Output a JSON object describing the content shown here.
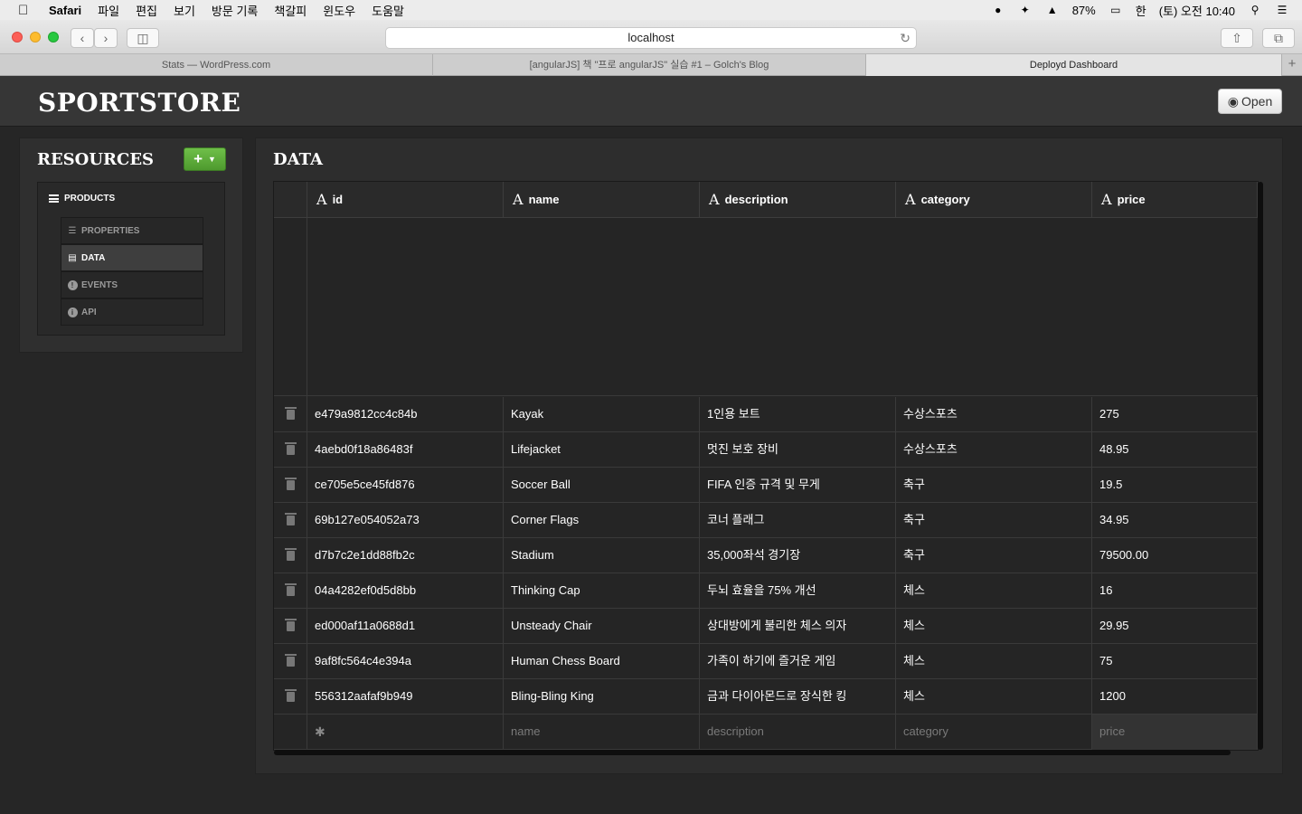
{
  "menubar": {
    "app_name": "Safari",
    "menus": [
      "파일",
      "편집",
      "보기",
      "방문 기록",
      "책갈피",
      "윈도우",
      "도움말"
    ],
    "battery": "87%",
    "input_method": "한",
    "clock": "(토) 오전 10:40"
  },
  "browser": {
    "url": "localhost",
    "tabs": [
      {
        "label": "Stats — WordPress.com"
      },
      {
        "label": "[angularJS] 책 \"프로 angularJS\" 실습 #1 – Golch's Blog"
      },
      {
        "label": "Deployd Dashboard"
      }
    ],
    "new_tab": "+"
  },
  "app": {
    "brand": "SPORTSTORE",
    "open_label": "Open"
  },
  "resources": {
    "title": "RESOURCES",
    "add_label": "+",
    "resource_name": "PRODUCTS",
    "subitems": [
      {
        "label": "PROPERTIES",
        "icon": "list-icon"
      },
      {
        "label": "DATA",
        "icon": "document-icon"
      },
      {
        "label": "EVENTS",
        "icon": "alert-icon"
      },
      {
        "label": "API",
        "icon": "info-icon"
      }
    ]
  },
  "data": {
    "title": "DATA",
    "type_glyph": "A",
    "columns": [
      "id",
      "name",
      "description",
      "category",
      "price"
    ],
    "rows": [
      {
        "id": "e479a9812cc4c84b",
        "name": "Kayak",
        "description": "1인용 보트",
        "category": "수상스포츠",
        "price": "275"
      },
      {
        "id": "4aebd0f18a86483f",
        "name": "Lifejacket",
        "description": "멋진 보호 장비",
        "category": "수상스포츠",
        "price": "48.95"
      },
      {
        "id": "ce705e5ce45fd876",
        "name": "Soccer Ball",
        "description": "FIFA 인증 규격 및 무게",
        "category": "축구",
        "price": "19.5"
      },
      {
        "id": "69b127e054052a73",
        "name": "Corner Flags",
        "description": "코너 플래그",
        "category": "축구",
        "price": "34.95"
      },
      {
        "id": "d7b7c2e1dd88fb2c",
        "name": "Stadium",
        "description": "35,000좌석 경기장",
        "category": "축구",
        "price": "79500.00"
      },
      {
        "id": "04a4282ef0d5d8bb",
        "name": "Thinking Cap",
        "description": "두뇌 효율을 75% 개선",
        "category": "체스",
        "price": "16"
      },
      {
        "id": "ed000af11a0688d1",
        "name": "Unsteady Chair",
        "description": "상대방에게 불리한 체스 의자",
        "category": "체스",
        "price": "29.95"
      },
      {
        "id": "9af8fc564c4e394a",
        "name": "Human Chess Board",
        "description": "가족이 하기에 즐거운 게임",
        "category": "체스",
        "price": "75"
      },
      {
        "id": "556312aafaf9b949",
        "name": "Bling-Bling King",
        "description": "금과 다이아몬드로 장식한 킹",
        "category": "체스",
        "price": "1200"
      }
    ],
    "new_row": {
      "id_glyph": "✱",
      "name_placeholder": "name",
      "description_placeholder": "description",
      "category_placeholder": "category",
      "price_placeholder": "price"
    }
  },
  "colors": {
    "accent_green": "#5aa838",
    "panel_bg": "#2d2d2d",
    "page_bg": "#262626"
  }
}
